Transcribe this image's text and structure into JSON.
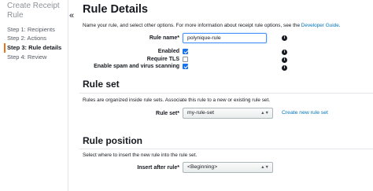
{
  "sidebar": {
    "title": "Create Receipt Rule",
    "steps": [
      {
        "label": "Step 1: Recipients"
      },
      {
        "label": "Step 2: Actions"
      },
      {
        "label": "Step 3: Rule details"
      },
      {
        "label": "Step 4: Review"
      }
    ],
    "active_step": 3
  },
  "collapse_glyph": "«",
  "rule_details": {
    "heading": "Rule Details",
    "description_prefix": "Name your rule, and select other options. For more information about receipt rule options, see the",
    "guide_link": "Developer Guide",
    "description_suffix": ".",
    "rule_name_label": "Rule name*",
    "rule_name_value": "polynique-rule",
    "enabled_label": "Enabled",
    "enabled_checked": true,
    "require_tls_label": "Require TLS",
    "require_tls_checked": false,
    "spam_label": "Enable spam and virus scanning",
    "spam_checked": true
  },
  "rule_set": {
    "heading": "Rule set",
    "description": "Rules are organized inside rule sets. Associate this rule to a new or existing rule set.",
    "label": "Rule set*",
    "selected": "my-rule-set",
    "create_link": "Create new rule set"
  },
  "rule_position": {
    "heading": "Rule position",
    "description": "Select where to insert the new rule into the rule set.",
    "label": "Insert after rule*",
    "selected": "<Beginning>"
  },
  "info_glyph": "i",
  "dropdown_glyph": "▲▼",
  "colors": {
    "accent": "#ec7211",
    "link": "#0073bb",
    "checkbox": "#1a73e8"
  }
}
